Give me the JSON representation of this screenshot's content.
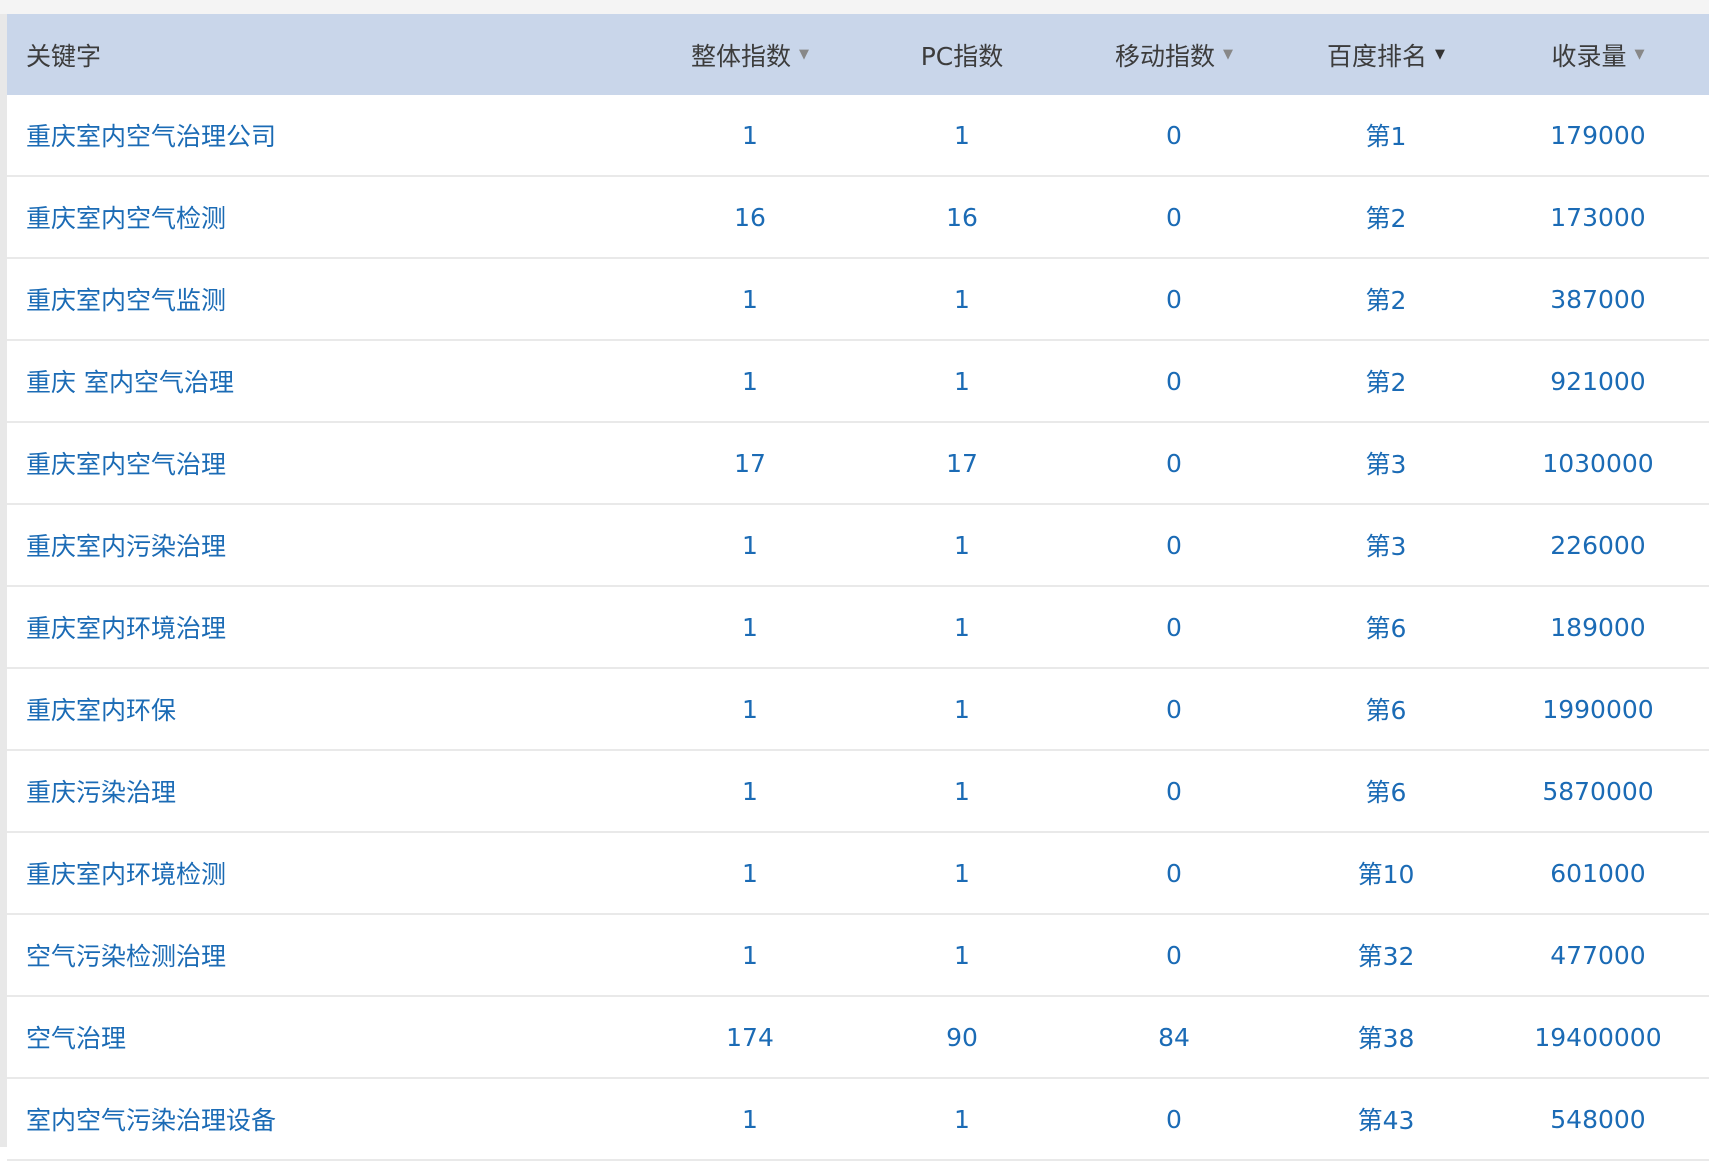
{
  "headers": {
    "keyword": "关键字",
    "overall_index": "整体指数",
    "pc_index": "PC指数",
    "mobile_index": "移动指数",
    "baidu_rank": "百度排名",
    "indexed_count": "收录量"
  },
  "sort_caret": "▼",
  "colors": {
    "header_bg": "#c9d6ea",
    "link": "#1b6bb5",
    "row_border": "#e9e9e9"
  },
  "rows": [
    {
      "keyword": "重庆室内空气治理公司",
      "overall": "1",
      "pc": "1",
      "mobile": "0",
      "rank": "第1",
      "indexed": "179000"
    },
    {
      "keyword": "重庆室内空气检测",
      "overall": "16",
      "pc": "16",
      "mobile": "0",
      "rank": "第2",
      "indexed": "173000"
    },
    {
      "keyword": "重庆室内空气监测",
      "overall": "1",
      "pc": "1",
      "mobile": "0",
      "rank": "第2",
      "indexed": "387000"
    },
    {
      "keyword": "重庆 室内空气治理",
      "overall": "1",
      "pc": "1",
      "mobile": "0",
      "rank": "第2",
      "indexed": "921000"
    },
    {
      "keyword": "重庆室内空气治理",
      "overall": "17",
      "pc": "17",
      "mobile": "0",
      "rank": "第3",
      "indexed": "1030000"
    },
    {
      "keyword": "重庆室内污染治理",
      "overall": "1",
      "pc": "1",
      "mobile": "0",
      "rank": "第3",
      "indexed": "226000"
    },
    {
      "keyword": "重庆室内环境治理",
      "overall": "1",
      "pc": "1",
      "mobile": "0",
      "rank": "第6",
      "indexed": "189000"
    },
    {
      "keyword": "重庆室内环保",
      "overall": "1",
      "pc": "1",
      "mobile": "0",
      "rank": "第6",
      "indexed": "1990000"
    },
    {
      "keyword": "重庆污染治理",
      "overall": "1",
      "pc": "1",
      "mobile": "0",
      "rank": "第6",
      "indexed": "5870000"
    },
    {
      "keyword": "重庆室内环境检测",
      "overall": "1",
      "pc": "1",
      "mobile": "0",
      "rank": "第10",
      "indexed": "601000"
    },
    {
      "keyword": "空气污染检测治理",
      "overall": "1",
      "pc": "1",
      "mobile": "0",
      "rank": "第32",
      "indexed": "477000"
    },
    {
      "keyword": "空气治理",
      "overall": "174",
      "pc": "90",
      "mobile": "84",
      "rank": "第38",
      "indexed": "19400000"
    },
    {
      "keyword": "室内空气污染治理设备",
      "overall": "1",
      "pc": "1",
      "mobile": "0",
      "rank": "第43",
      "indexed": "548000"
    }
  ]
}
